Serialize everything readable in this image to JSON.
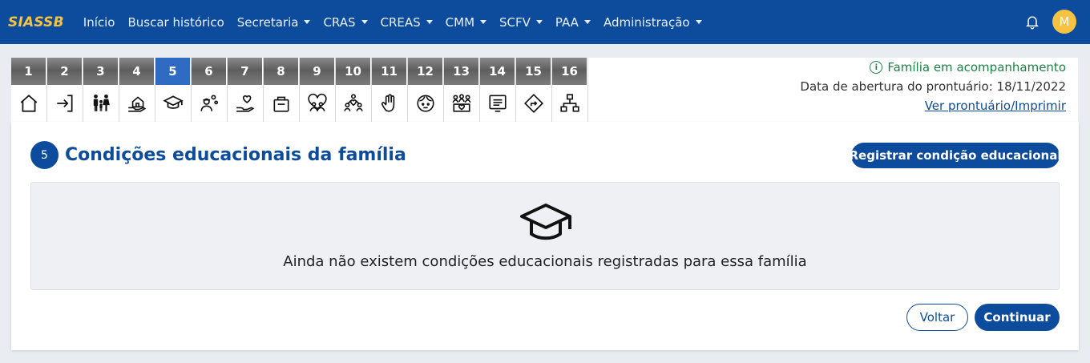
{
  "navbar": {
    "brand": "SIASSB",
    "items": [
      {
        "label": "Início",
        "dropdown": false
      },
      {
        "label": "Buscar histórico",
        "dropdown": false
      },
      {
        "label": "Secretaria",
        "dropdown": true
      },
      {
        "label": "CRAS",
        "dropdown": true
      },
      {
        "label": "CREAS",
        "dropdown": true
      },
      {
        "label": "CMM",
        "dropdown": true
      },
      {
        "label": "SCFV",
        "dropdown": true
      },
      {
        "label": "PAA",
        "dropdown": true
      },
      {
        "label": "Administração",
        "dropdown": true
      }
    ],
    "bell_icon": "bell-icon",
    "avatar_initial": "M"
  },
  "steps": [
    {
      "number": "1",
      "icon": "home-icon"
    },
    {
      "number": "2",
      "icon": "login-arrow-icon"
    },
    {
      "number": "3",
      "icon": "family-icon"
    },
    {
      "number": "4",
      "icon": "house-hand-icon"
    },
    {
      "number": "5",
      "icon": "graduation-cap-icon",
      "active": true
    },
    {
      "number": "6",
      "icon": "worker-gears-icon"
    },
    {
      "number": "7",
      "icon": "hand-heart-icon"
    },
    {
      "number": "8",
      "icon": "basket-icon"
    },
    {
      "number": "9",
      "icon": "people-heart-icon"
    },
    {
      "number": "10",
      "icon": "community-icon"
    },
    {
      "number": "11",
      "icon": "raised-hand-icon"
    },
    {
      "number": "12",
      "icon": "child-face-icon"
    },
    {
      "number": "13",
      "icon": "group-heart-icon"
    },
    {
      "number": "14",
      "icon": "document-list-icon"
    },
    {
      "number": "15",
      "icon": "direction-sign-icon"
    },
    {
      "number": "16",
      "icon": "org-chart-icon"
    }
  ],
  "info": {
    "status": "Família em acompanhamento",
    "opening_label": "Data de abertura do prontuário: 18/11/2022",
    "print_link": "Ver prontuário/Imprimir"
  },
  "section": {
    "number": "5",
    "title": "Condições educacionais da família",
    "register_button": "Registrar condição educacional",
    "empty_message": "Ainda não existem condições educacionais registradas para essa família",
    "back_button": "Voltar",
    "continue_button": "Continuar"
  },
  "colors": {
    "primary": "#0d4c9c",
    "brand_accent": "#f5c242",
    "status_green": "#1e8046",
    "step_inactive": "#6e6e6e",
    "step_active": "#2f6bc2"
  }
}
